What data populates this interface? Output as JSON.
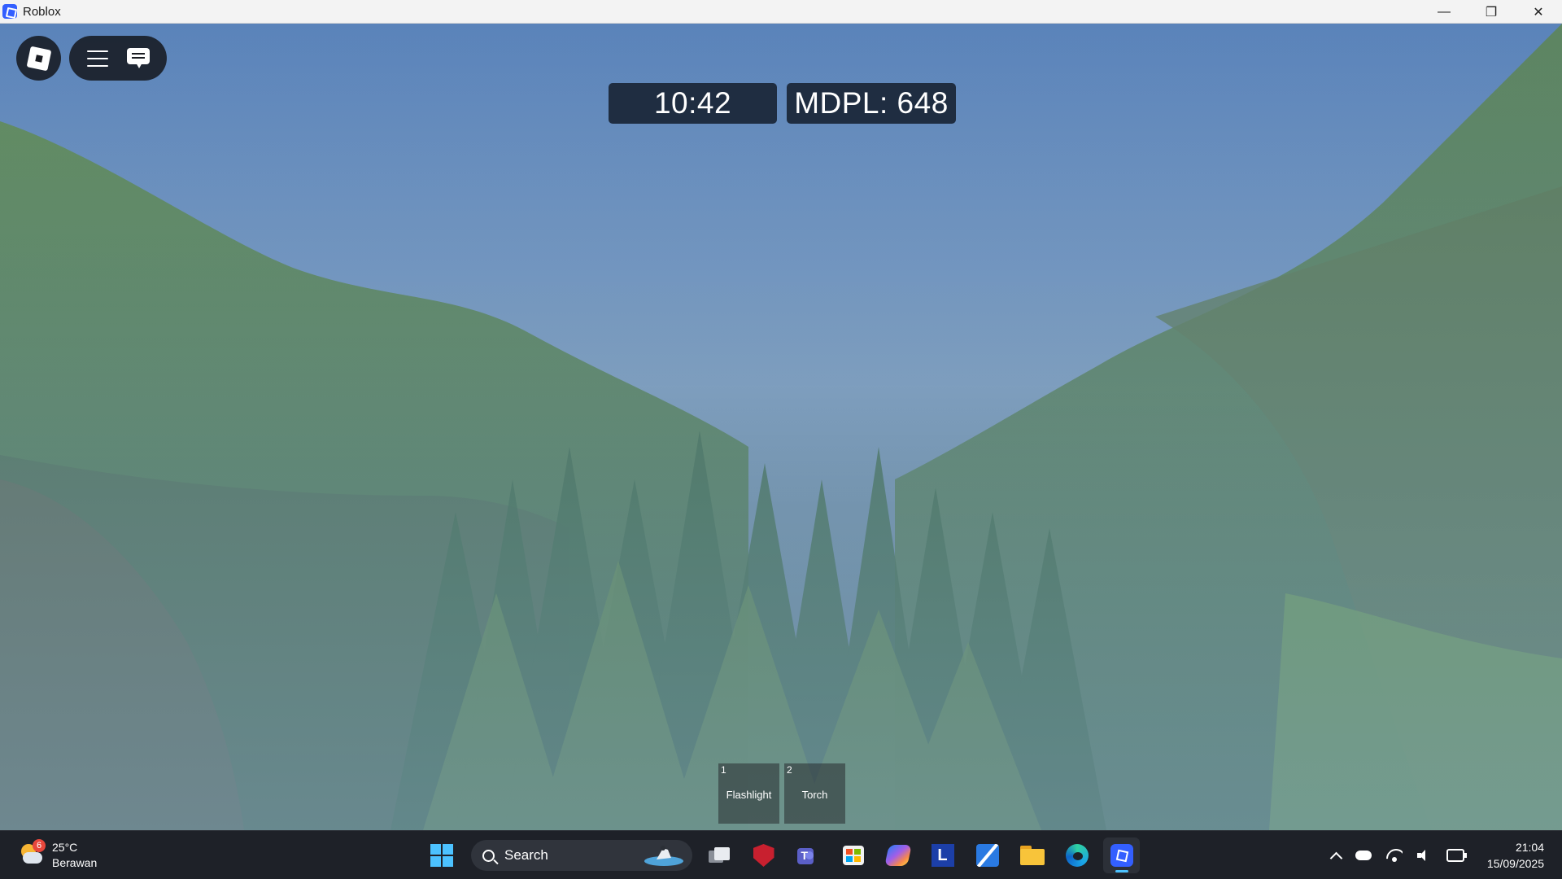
{
  "window": {
    "title": "Roblox",
    "controls": {
      "minimize": "—",
      "restore": "❐",
      "close": "✕"
    }
  },
  "hud": {
    "time": "10:42",
    "elevation": "MDPL: 648"
  },
  "hotbar": {
    "slots": [
      {
        "number": "1",
        "label": "Flashlight"
      },
      {
        "number": "2",
        "label": "Torch"
      }
    ]
  },
  "taskbar": {
    "weather": {
      "temperature": "25°C",
      "condition": "Berawan",
      "badge": "6"
    },
    "search_label": "Search",
    "pinned": [
      "start-icon",
      "search-icon",
      "task-view-icon",
      "mcafee-icon",
      "teams-icon",
      "microsoft-store-icon",
      "copilot-icon",
      "l-app-icon",
      "pen-app-icon",
      "file-explorer-icon",
      "edge-icon",
      "roblox-icon"
    ],
    "clock": {
      "time": "21:04",
      "date": "15/09/2025"
    }
  },
  "colors": {
    "accent": "#4cc2ff",
    "roblox_blue": "#335fff",
    "taskbar_bg": "#1e2128",
    "hud_box": "#162030"
  }
}
